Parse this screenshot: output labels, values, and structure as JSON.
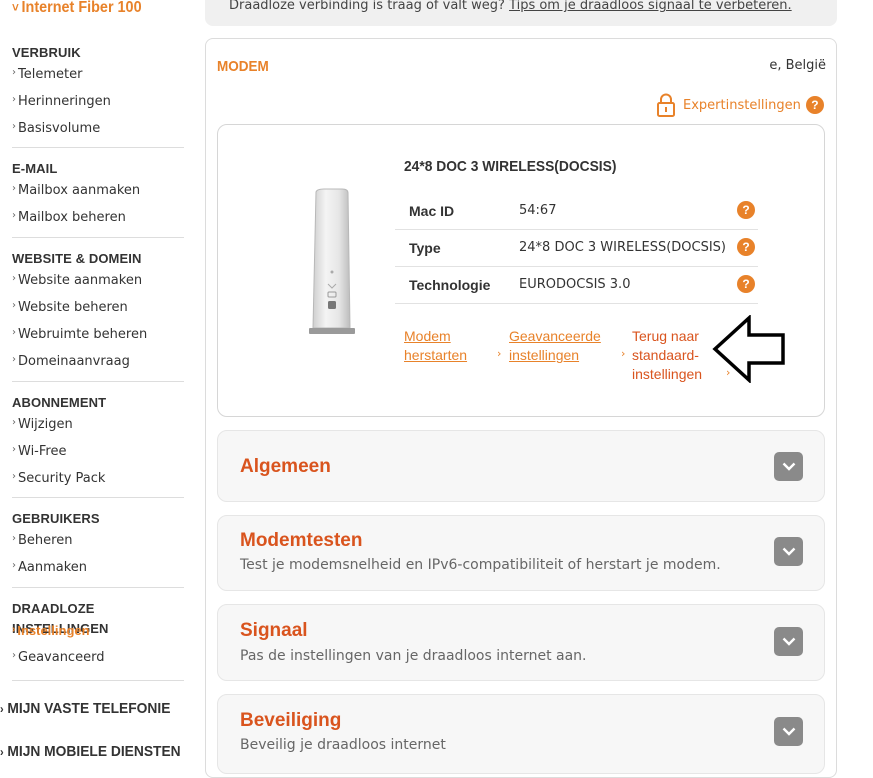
{
  "sidebar": {
    "top_item": "Internet Fiber 100",
    "sections": [
      {
        "heading": "VERBRUIK",
        "items": [
          "Telemeter",
          "Herinneringen",
          "Basisvolume"
        ]
      },
      {
        "heading": "E-MAIL",
        "items": [
          "Mailbox aanmaken",
          "Mailbox beheren"
        ]
      },
      {
        "heading": "WEBSITE & DOMEIN",
        "items": [
          "Website aanmaken",
          "Website beheren",
          "Webruimte beheren",
          "Domeinaanvraag"
        ]
      },
      {
        "heading": "ABONNEMENT",
        "items": [
          "Wijzigen",
          "Wi-Free",
          "Security Pack"
        ]
      },
      {
        "heading": "GEBRUIKERS",
        "items": [
          "Beheren",
          "Aanmaken"
        ]
      },
      {
        "heading": "DRAADLOZE INSTELLINGEN",
        "items": [
          "Instellingen",
          "Geavanceerd"
        ],
        "active_item": "Instellingen"
      }
    ],
    "bottom_items": [
      "MIJN VASTE TELEFONIE",
      "MIJN MOBIELE DIENSTEN"
    ]
  },
  "infobar": {
    "text": "Draadloze verbinding is traag of valt weg? ",
    "link": "Tips om je draadloos signaal te verbeteren."
  },
  "modem": {
    "title": "MODEM",
    "location": "e, België",
    "expert_link": "Expertinstellingen",
    "device_name": "24*8 DOC 3 WIRELESS(DOCSIS)",
    "specs": [
      {
        "label": "Mac ID",
        "value": "54:67"
      },
      {
        "label": "Type",
        "value": "24*8 DOC 3 WIRELESS(DOCSIS)"
      },
      {
        "label": "Technologie",
        "value": "EURODOCSIS 3.0"
      }
    ],
    "actions": {
      "restart": [
        "Modem",
        "herstarten"
      ],
      "advanced": [
        "Geavanceerde",
        "instellingen"
      ],
      "reset": [
        "Terug naar",
        "standaard-",
        "instellingen"
      ]
    }
  },
  "accordions": [
    {
      "title": "Algemeen",
      "description": ""
    },
    {
      "title": "Modemtesten",
      "description": "Test je modemsnelheid en IPv6-compatibiliteit of herstart je modem."
    },
    {
      "title": "Signaal",
      "description": "Pas de instellingen van je draadloos internet aan."
    },
    {
      "title": "Beveiliging",
      "description": "Beveilig je draadloos internet"
    }
  ],
  "colors": {
    "accent": "#e8822a",
    "accent_dark": "#d9541e"
  }
}
